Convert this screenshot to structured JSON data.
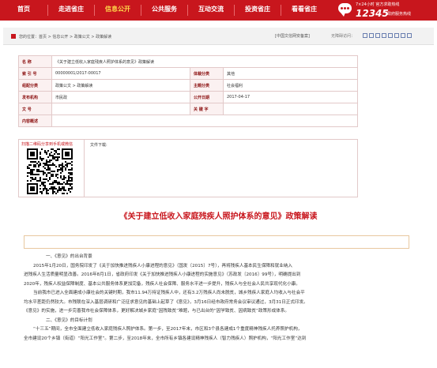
{
  "nav": {
    "items": [
      "首页",
      "走进省庄",
      "信息公开",
      "公共服务",
      "互动交流",
      "投资省庄",
      "看看省庄"
    ],
    "active_index": 2
  },
  "hotline": {
    "line1": "7×24小时 官方求助热线",
    "number": "12345",
    "sub": "政府服务热线"
  },
  "breadcrumb": {
    "text": "您的位置：首页 > 信息公开 > 政策公文 > 政策解读",
    "compat": "[中国文信网安备案]",
    "a11y": "无障碍访问："
  },
  "info": {
    "name_label": "名 称",
    "name_value": "《关于建立低收入家庭残疾人照护体系的意见》政策解读",
    "index_label": "索 引 号",
    "index_value": "00000001/2017-00017",
    "topic_label": "体裁分类",
    "topic_value": "其他",
    "category_label": "组配分类",
    "category_value": "政策公文 > 政策解读",
    "subject_label": "主题分类",
    "subject_value": "社会福利",
    "org_label": "发布机构",
    "org_value": "市民政",
    "date_label": "公开日期",
    "date_value": "2017-04-17",
    "docno_label": "文 号",
    "docno_value": "",
    "keyword_label": "关 键 字",
    "keyword_value": "",
    "summary_label": "内容概述",
    "summary_value": ""
  },
  "qr": {
    "tip": "扫描二维码分享到手机或微信",
    "download": "文件下载:"
  },
  "article": {
    "title": "《关于建立低收入家庭残疾人照护体系的意见》政策解读",
    "paragraphs": [
      {
        "cls": "h",
        "text": "一、《意见》的出台背景"
      },
      {
        "cls": "ind",
        "text": "2015年1月20日，国务院印发了《关于加快推进残疾人小康进程的意见》（国发〔2015〕7号），再将残疾人基本民生保障和就业纳入"
      },
      {
        "cls": "",
        "text": "进残疾人生活质量明显改善。2016年8月1日，省政府印发《关于加快推进残疾人小康进程的实施意见》（苏政发〔2016〕99号），明确提出到"
      },
      {
        "cls": "",
        "text": "2020年，残疾人权益保障制度、基本公共服务体系更加完备，残疾人社会保障、服务水平进一步提升，残疾人与全社会人民共享现代化小康。"
      },
      {
        "cls": "ind",
        "text": "当前我市已进入全面建成小康社会的关键时期，我市11.94万持证残疾人中，还有3.2万残疾人尚未脱贫，城乡残疾人家庭人均收入与社会平"
      },
      {
        "cls": "",
        "text": "均水平差距仍然较大。市残联在深入基层调研和广泛征求意见的基础上起草了《意见》，3月16日经市政府常务会议审议通过，3月31日正式印发。"
      },
      {
        "cls": "",
        "text": "《意见》的实施，进一步完善我市社会保障体系，更好解决城乡家庭“因残致贫”难题，与已出台的“因学致贫、因病致贫”政策形成体系。"
      },
      {
        "cls": "h",
        "text": "二、《意见》的目标计划"
      },
      {
        "cls": "ind",
        "text": "“十三五”期间，全市全面建立低收入家庭残疾人照护体系。第一步，至2017年末，市区和3个县各建成1个重度精神残疾人托养照护机构，"
      },
      {
        "cls": "",
        "text": "全市建设20个乡镇（街道）“阳光工作室”。第二步，至2018年末，全市所有乡镇各建设精神残疾人（智力残疾人）照护机构，“阳光工作室”达到"
      }
    ]
  }
}
